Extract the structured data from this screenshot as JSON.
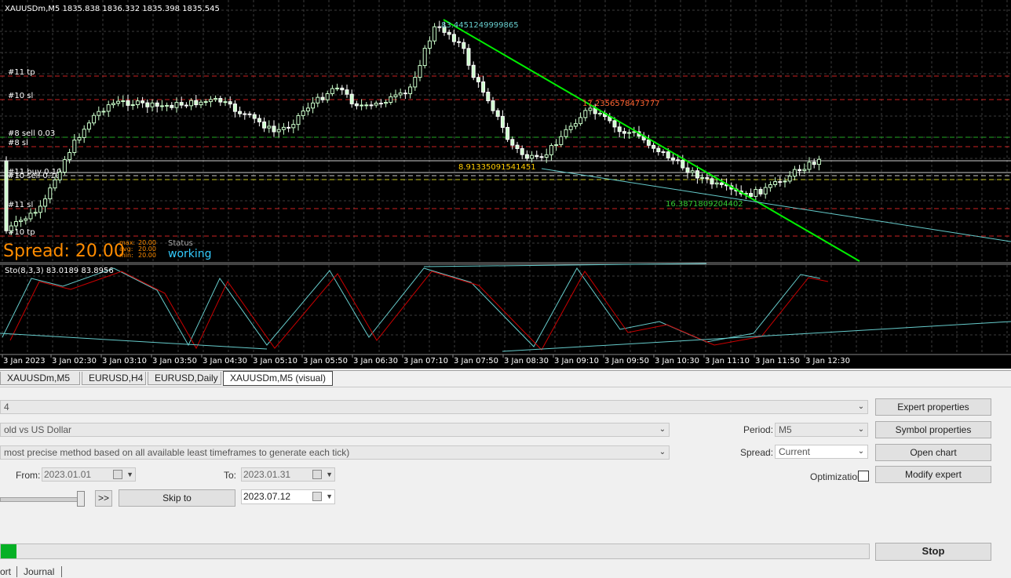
{
  "chart": {
    "symbol_header": "XAUUSDm,M5  1835.838 1836.332 1835.398 1835.545",
    "osc_header": "Sto(8,3,3) 83.0189 83.8956",
    "spread_label": "Spread: 20.00",
    "stats": [
      {
        "k": "max:",
        "v": "20.00"
      },
      {
        "k": "avg:",
        "v": "20.00"
      },
      {
        "k": "min:",
        "v": "20.00"
      }
    ],
    "status_label": "Status",
    "status_value": "working",
    "level_labels": [
      "#11 tp",
      "#10 sl",
      "#8 sell 0.03",
      "#8 sl",
      "#11 buy 0.10",
      "#10 sell 0.10",
      "#11 sl",
      "#10 tp"
    ],
    "annotations": [
      "83.4451249999865",
      "17.2356578473777",
      "8.91335091541451",
      "16.3871809204402"
    ],
    "time_labels": [
      "3 Jan 2023",
      "3 Jan 02:30",
      "3 Jan 03:10",
      "3 Jan 03:50",
      "3 Jan 04:30",
      "3 Jan 05:10",
      "3 Jan 05:50",
      "3 Jan 06:30",
      "3 Jan 07:10",
      "3 Jan 07:50",
      "3 Jan 08:30",
      "3 Jan 09:10",
      "3 Jan 09:50",
      "3 Jan 10:30",
      "3 Jan 11:10",
      "3 Jan 11:50",
      "3 Jan 12:30"
    ],
    "colors": {
      "bull": "#ccffcc",
      "bear": "#ffffff",
      "sto_main": "#66cccc",
      "sto_signal": "#cc0000",
      "trend": "#00ee00",
      "spread": "#ff8c00",
      "status": "#33ccff"
    }
  },
  "tabs": [
    "XAUUSDm,M5",
    "EURUSD,H4",
    "EURUSD,Daily",
    "XAUUSDm,M5 (visual)"
  ],
  "settings": {
    "expert_value": "4",
    "symbol_value": "old vs US Dollar",
    "model_value": "most precise method based on all available least timeframes to generate each tick)",
    "period_label": "Period:",
    "period_value": "M5",
    "spread_label": "Spread:",
    "spread_value": "Current",
    "from_label": "From:",
    "from_value": "2023.01.01",
    "to_label": "To:",
    "to_value": "2023.01.31",
    "skip_date": "2023.07.12",
    "optimization_label": "Optimization"
  },
  "buttons": {
    "expert_properties": "Expert properties",
    "symbol_properties": "Symbol properties",
    "open_chart": "Open chart",
    "modify_expert": "Modify expert",
    "fast_forward": ">>",
    "skip_to": "Skip to",
    "stop": "Stop"
  },
  "progress": {
    "fraction": 0.018
  },
  "bottom_tabs": [
    "ort",
    "Journal"
  ]
}
